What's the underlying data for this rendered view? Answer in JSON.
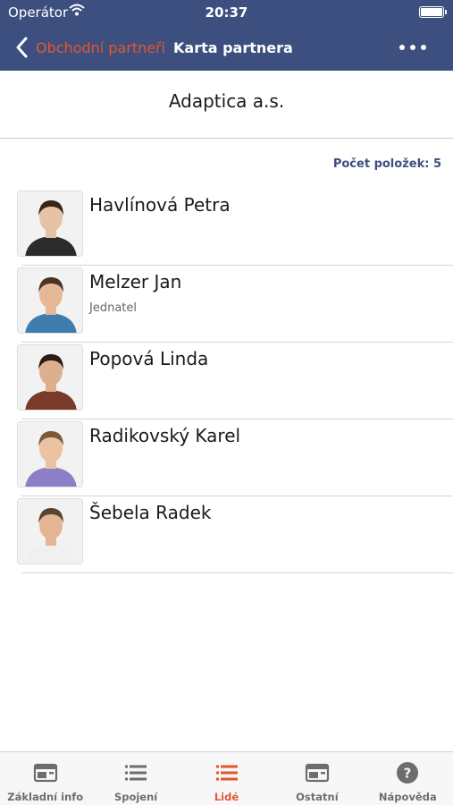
{
  "status_bar": {
    "carrier": "Operátor",
    "time": "20:37"
  },
  "nav": {
    "back_label": "Obchodní partneři",
    "title": "Karta partnera"
  },
  "company": {
    "name": "Adaptica a.s."
  },
  "list": {
    "count_label": "Počet položek: 5"
  },
  "people": [
    {
      "name": "Havlínová Petra",
      "role": "",
      "hair": "#3a2418",
      "shirt": "#2b2b2b",
      "skin": "#e8c2a4"
    },
    {
      "name": "Melzer Jan",
      "role": "Jednatel",
      "hair": "#4a3424",
      "shirt": "#3e7db0",
      "skin": "#e6b896"
    },
    {
      "name": "Popová Linda",
      "role": "",
      "hair": "#2a1c14",
      "shirt": "#7a3a2a",
      "skin": "#dcb08e"
    },
    {
      "name": "Radikovský Karel",
      "role": "",
      "hair": "#7a5a3a",
      "shirt": "#8d7fc7",
      "skin": "#ecc3a2"
    },
    {
      "name": "Šebela Radek",
      "role": "",
      "hair": "#5a4430",
      "shirt": "#f0f0f0",
      "skin": "#e4b594"
    }
  ],
  "tabs": [
    {
      "label": "Základní info",
      "icon": "card-icon",
      "active": false
    },
    {
      "label": "Spojení",
      "icon": "list-icon",
      "active": false
    },
    {
      "label": "Lidé",
      "icon": "list-icon",
      "active": true
    },
    {
      "label": "Ostatní",
      "icon": "card-icon",
      "active": false
    },
    {
      "label": "Nápověda",
      "icon": "help-icon",
      "active": false
    }
  ],
  "colors": {
    "nav_bg": "#3c4f7e",
    "accent": "#e4572e",
    "tab_inactive": "#6d6d6d"
  }
}
